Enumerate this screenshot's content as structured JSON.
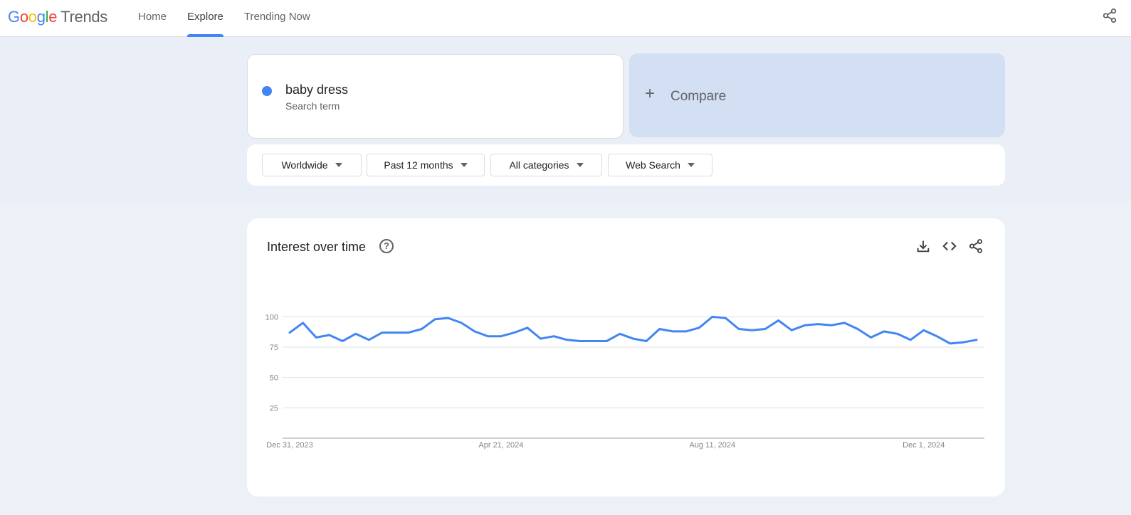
{
  "header": {
    "logo": {
      "letters": [
        "G",
        "o",
        "o",
        "g",
        "l",
        "e"
      ],
      "product": "Trends"
    },
    "nav": [
      {
        "label": "Home",
        "active": false
      },
      {
        "label": "Explore",
        "active": true
      },
      {
        "label": "Trending Now",
        "active": false
      }
    ]
  },
  "search": {
    "term": "baby dress",
    "term_type": "Search term",
    "term_color": "#4285f4",
    "compare_label": "Compare",
    "compare_plus": "+"
  },
  "filters": [
    {
      "label": "Worldwide"
    },
    {
      "label": "Past 12 months"
    },
    {
      "label": "All categories"
    },
    {
      "label": "Web Search"
    }
  ],
  "interest_over_time": {
    "title": "Interest over time",
    "help_glyph": "?"
  },
  "chart_data": {
    "type": "line",
    "title": "",
    "xlabel": "",
    "ylabel": "",
    "ylim": [
      0,
      100
    ],
    "y_ticks": [
      25,
      50,
      75,
      100
    ],
    "grid": true,
    "x_ticks": [
      {
        "index": 0,
        "label": "Dec 31, 2023"
      },
      {
        "index": 16,
        "label": "Apr 21, 2024"
      },
      {
        "index": 32,
        "label": "Aug 11, 2024"
      },
      {
        "index": 48,
        "label": "Dec 1, 2024"
      }
    ],
    "series": [
      {
        "name": "baby dress",
        "color": "#4285f4",
        "values": [
          87,
          95,
          83,
          85,
          80,
          86,
          81,
          87,
          87,
          87,
          90,
          98,
          99,
          95,
          88,
          84,
          84,
          87,
          91,
          82,
          84,
          81,
          80,
          80,
          80,
          86,
          82,
          80,
          90,
          88,
          88,
          91,
          100,
          99,
          90,
          89,
          90,
          97,
          89,
          93,
          94,
          93,
          95,
          90,
          83,
          88,
          86,
          81,
          89,
          84,
          78,
          79,
          81
        ]
      }
    ]
  }
}
